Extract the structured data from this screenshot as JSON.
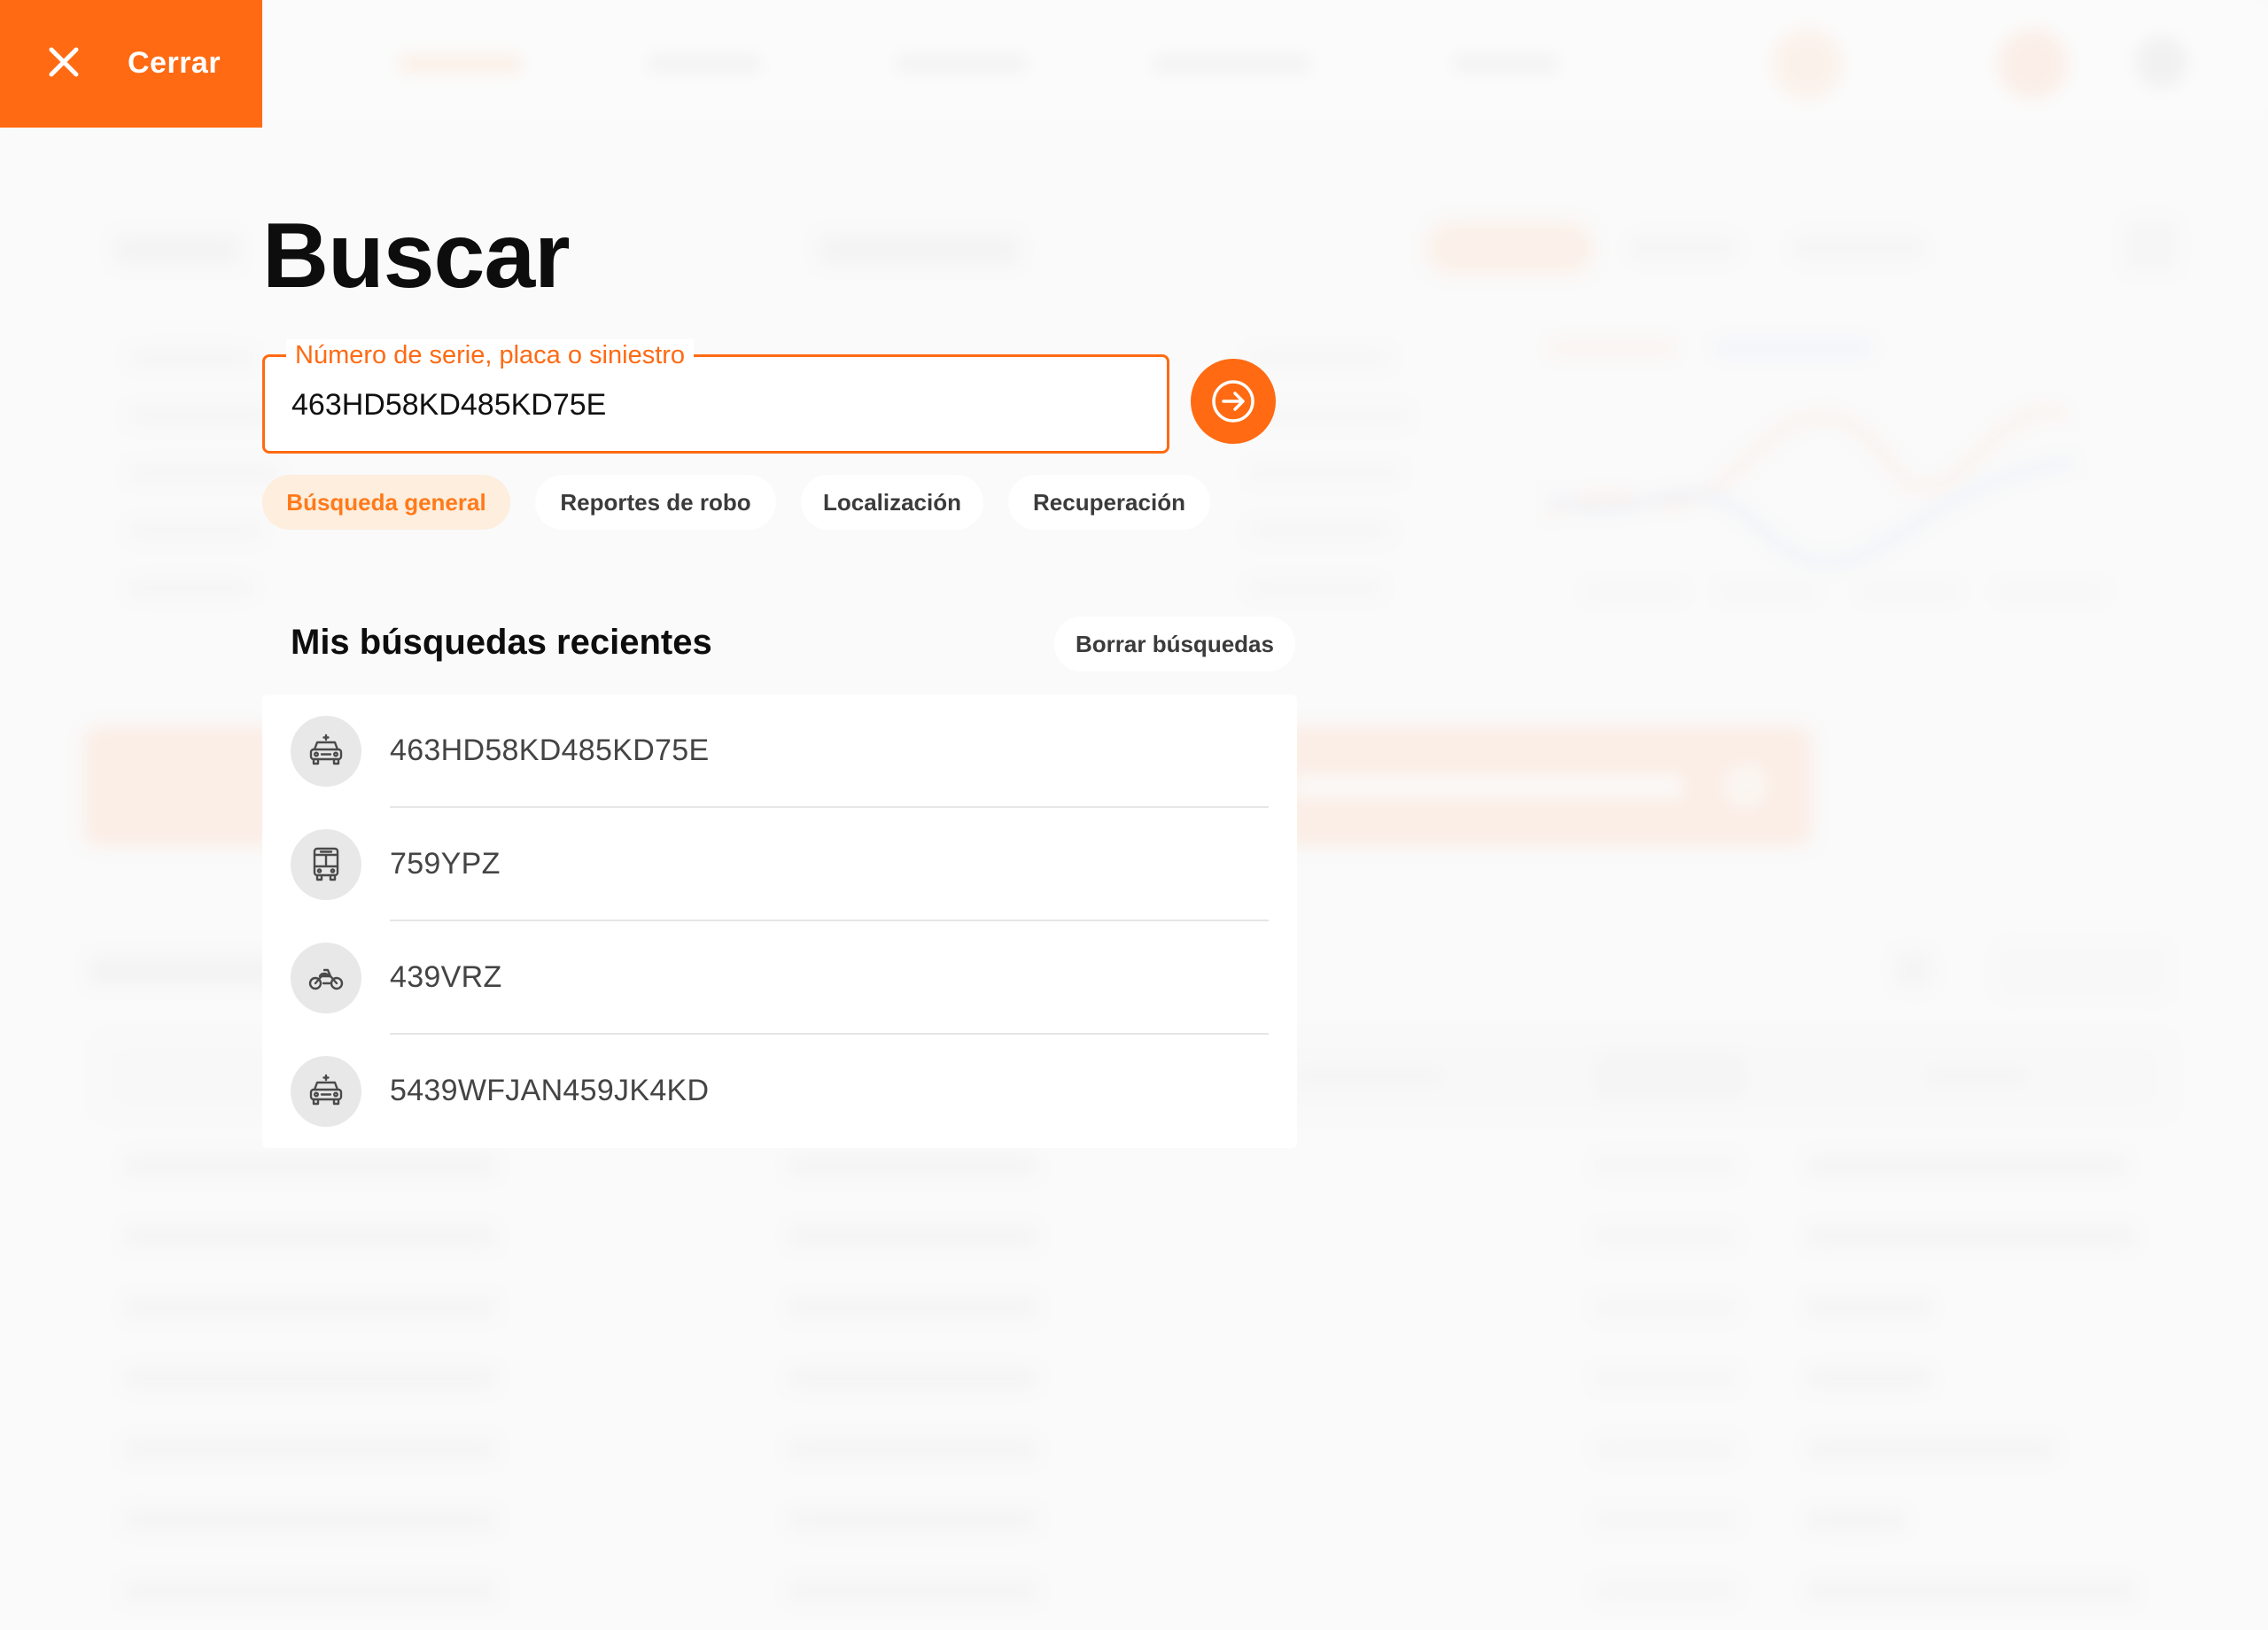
{
  "close_button": {
    "label": "Cerrar",
    "icon": "close-icon"
  },
  "search": {
    "title": "Buscar",
    "field_label": "Número de serie, placa o siniestro",
    "value": "463HD58KD485KD75E",
    "placeholder": "Número de serie, placa o siniestro",
    "submit_icon": "arrow-right-circle-icon"
  },
  "filters": [
    {
      "label": "Búsqueda general",
      "active": true
    },
    {
      "label": "Reportes de robo",
      "active": false
    },
    {
      "label": "Localización",
      "active": false
    },
    {
      "label": "Recuperación",
      "active": false
    }
  ],
  "recent": {
    "title": "Mis búsquedas recientes",
    "clear_label": "Borrar búsquedas",
    "items": [
      {
        "icon": "car-icon",
        "text": "463HD58KD485KD75E"
      },
      {
        "icon": "bus-icon",
        "text": "759YPZ"
      },
      {
        "icon": "motorcycle-icon",
        "text": "439VRZ"
      },
      {
        "icon": "car-icon",
        "text": "5439WFJAN459JK4KD"
      }
    ]
  },
  "colors": {
    "accent": "#ff6a13",
    "active_tab_bg": "#fdeede",
    "active_tab_text": "#ff7a1a",
    "icon_bg": "#e8e8e8",
    "icon_stroke": "#4a4a4a"
  }
}
